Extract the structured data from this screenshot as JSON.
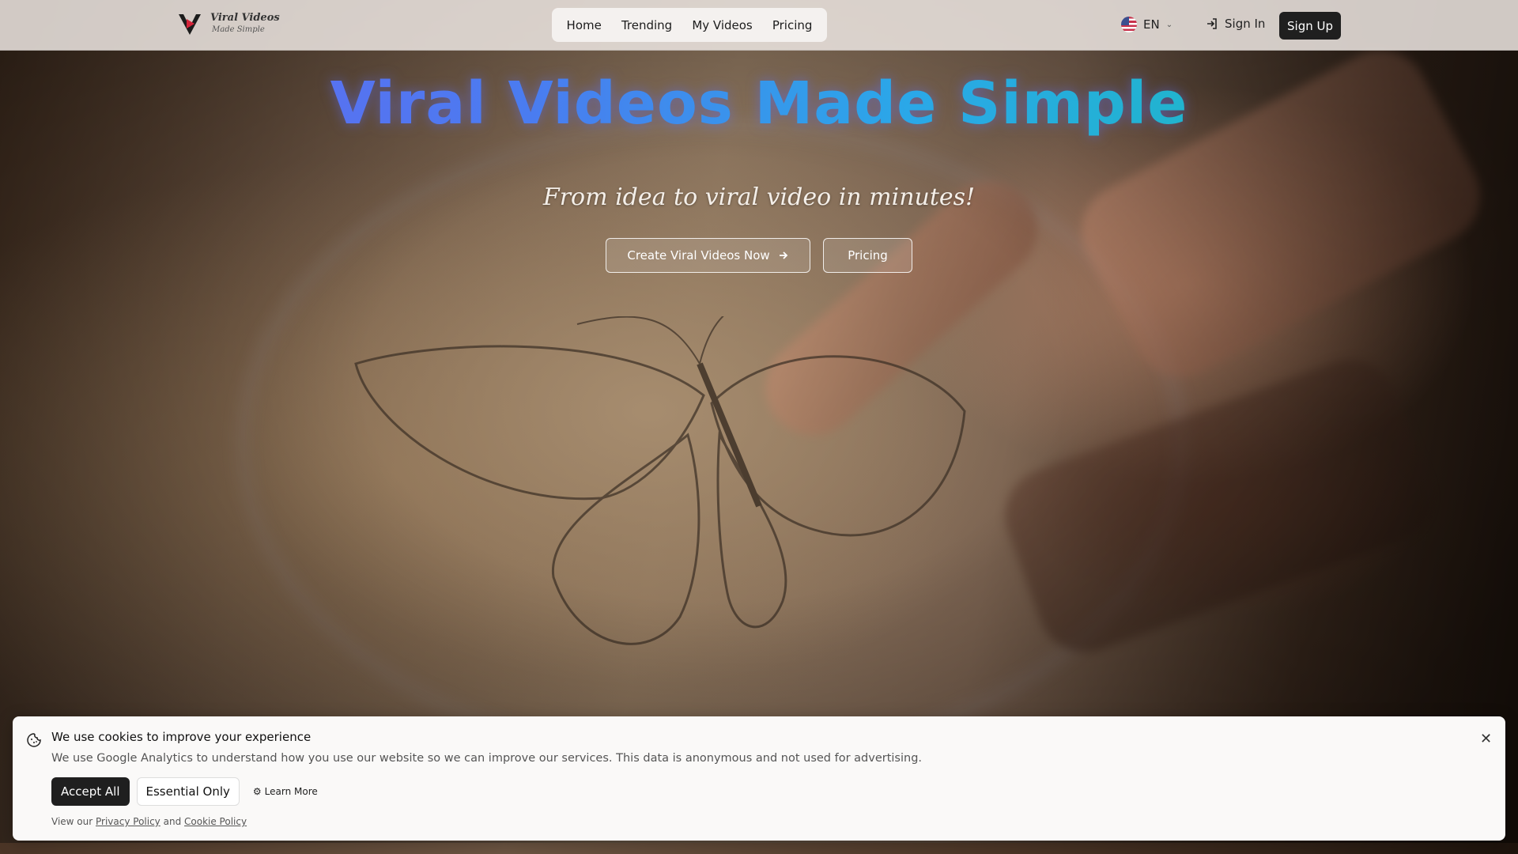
{
  "brand": {
    "title": "Viral Videos",
    "subtitle": "Made Simple"
  },
  "nav": {
    "links": [
      "Home",
      "Trending",
      "My Videos",
      "Pricing"
    ],
    "language": "EN",
    "sign_in": "Sign In",
    "sign_up": "Sign Up"
  },
  "hero": {
    "title": "Viral Videos Made Simple",
    "subtitle": "From idea to viral video in minutes!",
    "cta_primary": "Create Viral Videos Now",
    "cta_secondary": "Pricing"
  },
  "cookie_banner": {
    "title": "We use cookies to improve your experience",
    "description": "We use Google Analytics to understand how you use our website so we can improve our services. This data is anonymous and not used for advertising.",
    "accept_all": "Accept All",
    "essential_only": "Essential Only",
    "learn_more": "Learn More",
    "policy_prefix": "View our",
    "privacy_policy": "Privacy Policy",
    "and": "and",
    "cookie_policy": "Cookie Policy"
  },
  "icons": {
    "logo": "play-logo-icon",
    "flag": "us-flag-icon",
    "lang_chevron": "chevron-down-icon",
    "sign_in": "login-icon",
    "cta_arrow": "arrow-right-icon",
    "cookie": "cookie-icon",
    "close": "close-icon",
    "learn_more": "gear-icon"
  },
  "colors": {
    "title_gradient": [
      "#6b63f0",
      "#4a7cf0",
      "#2aa8e8",
      "#16c1b0"
    ],
    "primary_button": "#1f1f1f",
    "logo_accent": "#d4243a"
  }
}
